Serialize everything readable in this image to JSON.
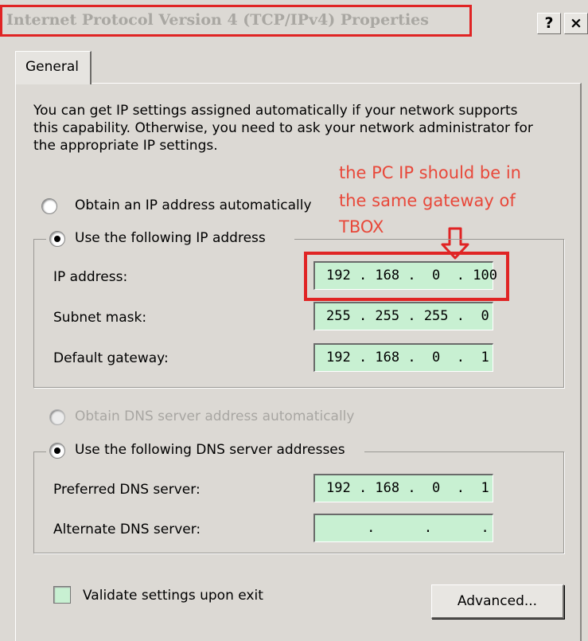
{
  "window": {
    "title": "Internet Protocol Version 4 (TCP/IPv4) Properties",
    "help_label": "?",
    "close_label": "×"
  },
  "tabs": [
    {
      "label": "General"
    }
  ],
  "description": "You can get IP settings assigned automatically if your network supports this capability. Otherwise, you need to ask your network administrator for the appropriate IP settings.",
  "annotation": {
    "lines": [
      "the PC IP should be in",
      "the same gateway of",
      "TBOX"
    ],
    "color": "#e8483a"
  },
  "ip_settings": {
    "auto_option": {
      "label": "Obtain an IP address automatically",
      "selected": false
    },
    "manual_option": {
      "label": "Use the following IP address",
      "selected": true
    },
    "fields": [
      {
        "label": "IP address:",
        "value": "192 . 168 .  0  . 100"
      },
      {
        "label": "Subnet mask:",
        "value": "255 . 255 . 255 .  0"
      },
      {
        "label": "Default gateway:",
        "value": "192 . 168 .  0  .  1"
      }
    ]
  },
  "dns_settings": {
    "auto_option": {
      "label": "Obtain DNS server address automatically",
      "selected": false,
      "disabled": true
    },
    "manual_option": {
      "label": "Use the following DNS server addresses",
      "selected": true
    },
    "fields": [
      {
        "label": "Preferred DNS server:",
        "value": "192 . 168 .  0  .  1"
      },
      {
        "label": "Alternate DNS server:",
        "value": "     .      .      .   "
      }
    ]
  },
  "validate": {
    "label": "Validate settings upon exit",
    "checked": false
  },
  "advanced_button": {
    "label": "Advanced..."
  },
  "colors": {
    "dialog_bg": "#dcd9d4",
    "field_bg": "#c8f0d2",
    "highlight": "#e02424"
  }
}
